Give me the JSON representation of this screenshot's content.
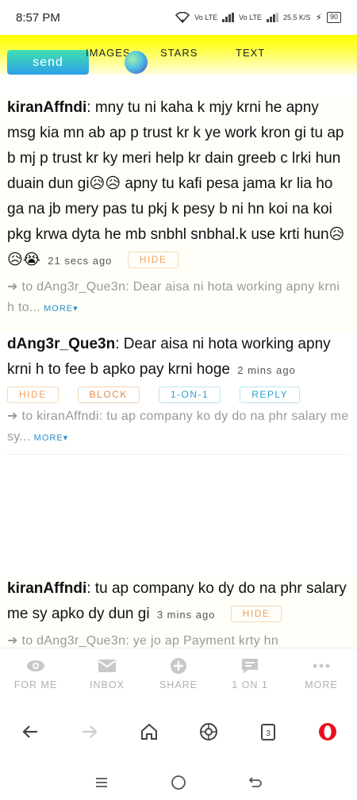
{
  "status_bar": {
    "time": "8:57 PM",
    "network1": "Vo LTE",
    "network2": "Vo LTE",
    "speed": "25.5 K/S",
    "battery": "90"
  },
  "top_bar": {
    "send_label": "send",
    "nav": [
      "IMAGES",
      "STARS",
      "TEXT"
    ]
  },
  "messages": [
    {
      "user": "kiranAffndi",
      "text": ": mny tu ni kaha k mjy krni he apny msg kia mn ab ap p trust kr k ye work kron gi tu ap b mj p trust kr ky meri help kr dain greeb c lrki hun duain dun gi😥😥 apny tu kafi pesa jama kr lia ho ga na jb mery pas tu pkj k pesy b ni hn koi na koi pkg krwa dyta he mb snbhl snbhal.k use krti hun😥😥😭",
      "ago": "21 secs ago",
      "hide": "HIDE",
      "reply": "➜ to dAng3r_Que3n: Dear aisa ni hota working apny krni h to...",
      "more": "MORE▾"
    },
    {
      "user": "dAng3r_Que3n",
      "text": ": Dear aisa ni hota working apny krni h to fee b apko pay krni hoge",
      "ago": "2 mins ago",
      "actions": [
        "HIDE",
        "BLOCK",
        "1-ON-1",
        "REPLY"
      ],
      "reply": "➜ to kiranAffndi: tu ap company ko dy do na phr salary me sy...",
      "more": "MORE▾"
    },
    {
      "user": "kiranAffndi",
      "text": ": tu ap company ko dy do na phr salary me sy apko dy dun gi",
      "ago": "3 mins ago",
      "hide": "HIDE",
      "reply": "➜ to dAng3r_Que3n: ye jo ap Payment krty hn"
    }
  ],
  "bottom_nav": [
    "FOR ME",
    "INBOX",
    "SHARE",
    "1 ON 1",
    "MORE"
  ],
  "browser": {
    "tabs_count": "3"
  },
  "colors": {
    "accent_yellow": "#ffff00",
    "pill_orange": "#f0a060",
    "pill_blue": "#2aa0d0",
    "link_blue": "#2a8fc8"
  }
}
